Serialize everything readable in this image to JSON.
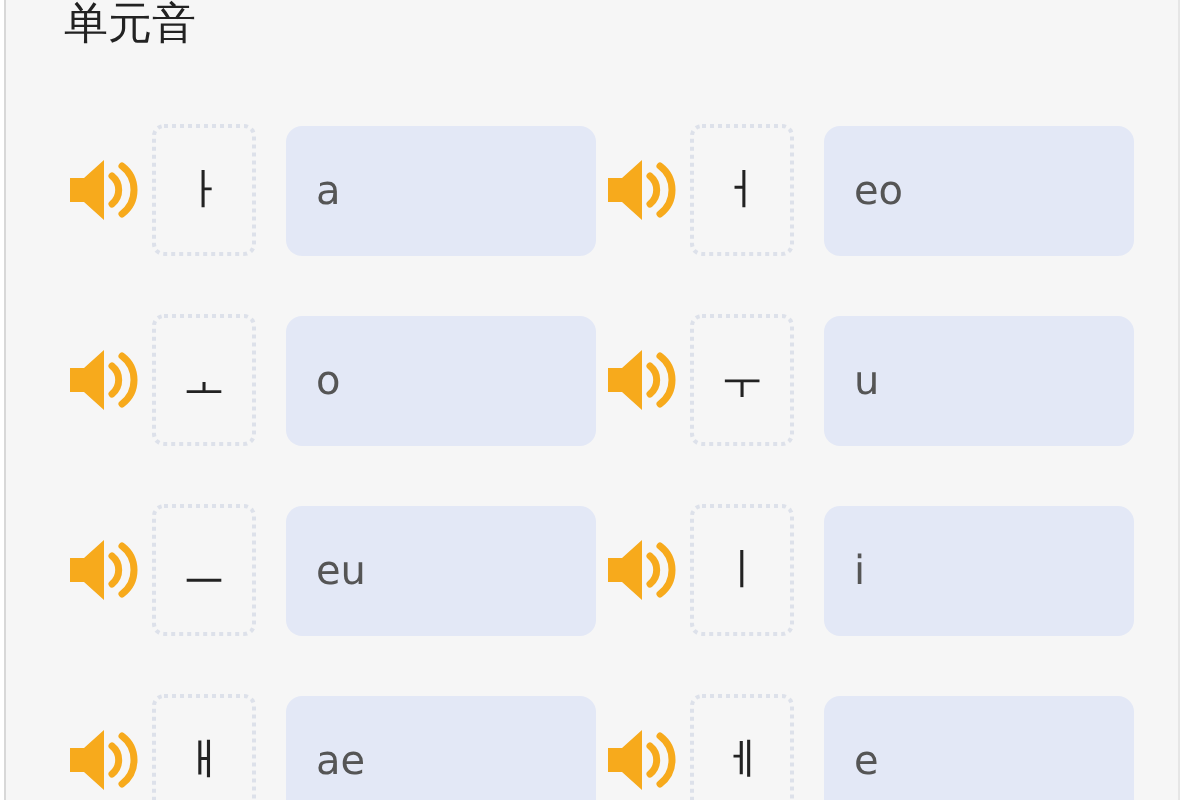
{
  "title": "单元音",
  "vowels": [
    {
      "letter": "ㅏ",
      "answer": "a"
    },
    {
      "letter": "ㅓ",
      "answer": "eo"
    },
    {
      "letter": "ㅗ",
      "answer": "o"
    },
    {
      "letter": "ㅜ",
      "answer": "u"
    },
    {
      "letter": "ㅡ",
      "answer": "eu"
    },
    {
      "letter": "ㅣ",
      "answer": "i"
    },
    {
      "letter": "ㅐ",
      "answer": "ae"
    },
    {
      "letter": "ㅔ",
      "answer": "e"
    }
  ]
}
